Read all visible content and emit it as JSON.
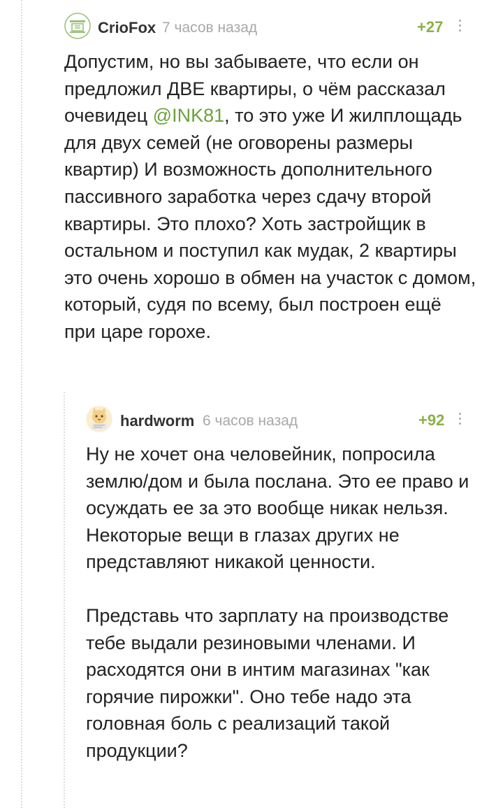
{
  "comments": [
    {
      "author": "CrioFox",
      "time": "7 часов назад",
      "rating": "+27",
      "avatar_icon": "default-avatar-icon",
      "body": {
        "before": "Допустим, но вы забываете, что если он предложил ДВЕ квартиры, о чём рассказал очевидец ",
        "mention": "@INK81",
        "after": ", то это уже И жилплощадь для двух семей (не оговорены размеры квартир) И возможность дополнительного пассивного заработка через сдачу второй квартиры. Это плохо? Хоть застройщик в остальном и поступил как мудак, 2 квартиры это очень хорошо в обмен на участок с домом, который, судя по всему, был построен ещё при царе горохе."
      }
    },
    {
      "author": "hardworm",
      "time": "6 часов назад",
      "rating": "+92",
      "avatar_icon": "cat-avatar-icon",
      "paragraphs": [
        "Ну не хочет она человейник, попросила землю/дом и была послана. Это ее право и осуждать ее за это вообще никак нельзя. Некоторые вещи в глазах других не представляют никакой ценности.",
        "Представь что зарплату на производстве тебе выдали резиновыми членами. И расходятся они в интим магазинах \"как горячие пирожки\". Оно тебе надо эта головная боль с реализаций такой продукции?"
      ]
    }
  ],
  "colors": {
    "rating": "#8ab146",
    "mention": "#6aa33c",
    "timestamp": "#a8a8a8",
    "text": "#222222",
    "thread_line": "#dddddd"
  }
}
